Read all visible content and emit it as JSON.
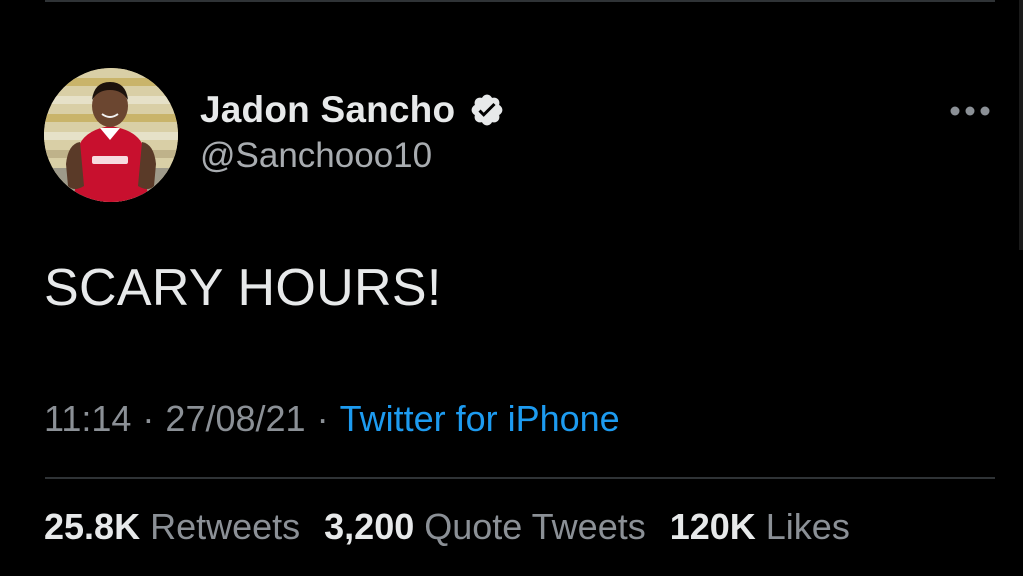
{
  "tweet": {
    "author": {
      "display_name": "Jadon Sancho",
      "handle": "@Sanchooo10",
      "verified": true,
      "avatar_icon": "profile-photo"
    },
    "text": "SCARY HOURS!",
    "meta": {
      "time": "11:14",
      "separator": "·",
      "date": "27/08/21",
      "source": "Twitter for iPhone"
    },
    "stats": {
      "retweets_count": "25.8K",
      "retweets_label": "Retweets",
      "quotes_count": "3,200",
      "quotes_label": "Quote Tweets",
      "likes_count": "120K",
      "likes_label": "Likes"
    }
  },
  "icons": {
    "verified": "verified-badge-icon",
    "more": "more-options-icon"
  },
  "colors": {
    "background": "#000000",
    "primary_text": "#e7e9ea",
    "secondary_text": "#8b9096",
    "link": "#1d9bf0",
    "divider": "#2f3336",
    "jersey_red": "#c8102e"
  }
}
